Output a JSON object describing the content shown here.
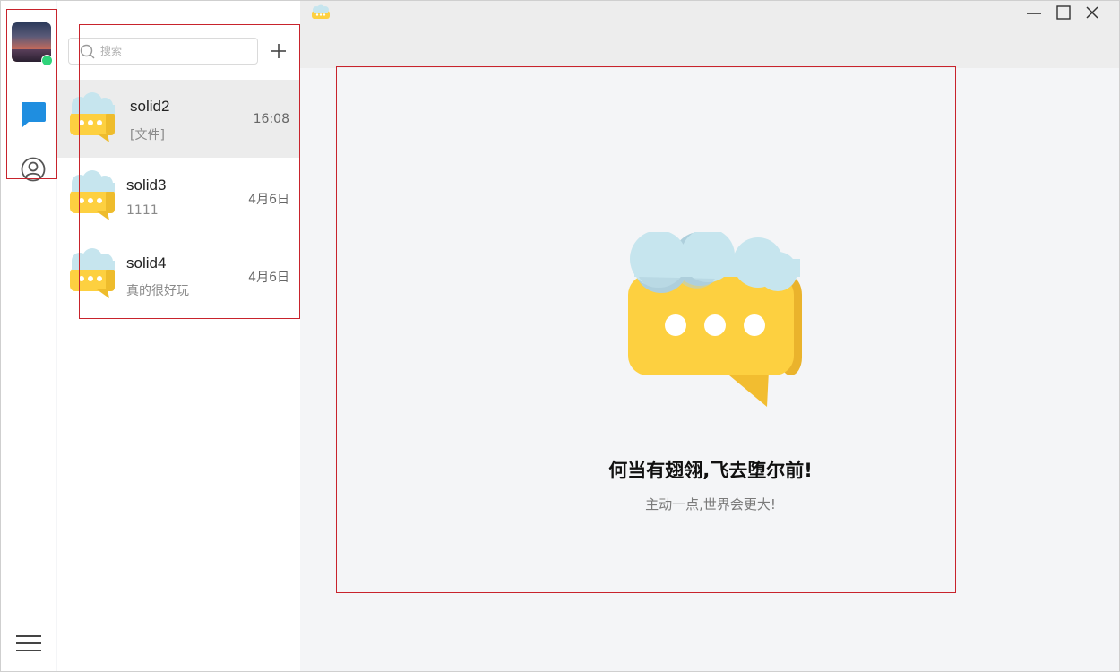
{
  "app": {
    "logo_icon": "chat-bubble-cloud-icon"
  },
  "rail": {
    "avatar": "user-avatar",
    "status": "online",
    "status_color": "#2fd37a",
    "nav": [
      {
        "icon": "chat-icon",
        "active": true,
        "color": "#1f8ee0"
      },
      {
        "icon": "contacts-icon",
        "active": false
      }
    ],
    "menu_icon": "hamburger-icon"
  },
  "search": {
    "placeholder": "搜索",
    "value": ""
  },
  "add_icon": "plus-icon",
  "conversations": [
    {
      "name": "solid2",
      "preview": "[文件]",
      "time": "16:08",
      "active": true
    },
    {
      "name": "solid3",
      "preview": "1111",
      "time": "4月6日",
      "active": false
    },
    {
      "name": "solid4",
      "preview": "真的很好玩",
      "time": "4月6日",
      "active": false
    }
  ],
  "window_controls": [
    "minimize-icon",
    "maximize-icon",
    "close-icon"
  ],
  "main": {
    "slogan": "何当有翅翎,飞去堕尔前!",
    "subtitle": "主动一点,世界会更大!"
  },
  "colors": {
    "accent": "#1f8ee0",
    "bubble_yellow": "#fdd040",
    "cloud": "#c6e5ee"
  }
}
